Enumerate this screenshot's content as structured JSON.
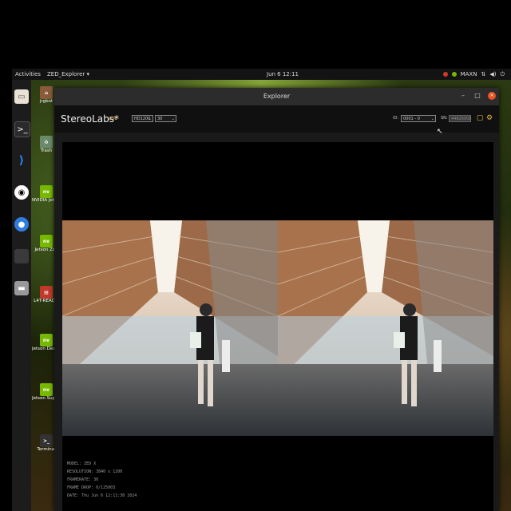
{
  "topbar": {
    "activities": "Activities",
    "app_menu": "ZED_Explorer ▾",
    "clock": "Jun 6 12:11",
    "power_mode": "MAXN",
    "tray_icons": [
      "nvidia-icon",
      "power-mode-icon",
      "network-icon",
      "volume-icon",
      "power-icon"
    ]
  },
  "dock": {
    "icons": [
      "files-icon",
      "terminal-icon",
      "vscode-icon",
      "obs-icon",
      "chromium-icon",
      "blank-app-icon",
      "disk-icon"
    ]
  },
  "desktop_icons": [
    {
      "label": "jrgbot",
      "icon": "home-folder-icon",
      "color": "#8a5a3a"
    },
    {
      "label": "Trash",
      "icon": "trash-icon",
      "color": "#6a8a6a"
    },
    {
      "label": "NVIDIA Jets Community F",
      "icon": "nvidia-icon",
      "color": "#76b900"
    },
    {
      "label": "Jetson Zoo",
      "icon": "nvidia-icon",
      "color": "#76b900"
    },
    {
      "label": "L4T-READM",
      "icon": "folder-icon",
      "color": "#c0392b"
    },
    {
      "label": "Jetson Developer Z",
      "icon": "nvidia-icon",
      "color": "#76b900"
    },
    {
      "label": "Jetson Supp Forums",
      "icon": "nvidia-icon",
      "color": "#76b900"
    },
    {
      "label": "Terminal",
      "icon": "terminal-icon",
      "color": "#333333"
    }
  ],
  "window": {
    "title": "Explorer",
    "buttons": {
      "minimize": "–",
      "maximize": "□",
      "close": "×"
    }
  },
  "toolbar": {
    "brand": "StereoLabs*",
    "live": "LIVE",
    "resolution_select": "HD1200",
    "fps_select": "30",
    "id_label": "ID:",
    "camera_select": "0001 - 0",
    "sn_label": "SN:",
    "serial_placeholder": "44826908"
  },
  "info": {
    "model": "MODEL: ZED X",
    "resolution": "RESOLUTION: 3840 x 1200",
    "framerate": "FRAMERATE: 30",
    "frame_drop": "FRAME DROP: 0/125003",
    "date": "DATE: Thu Jun 6 12:11:30 2024"
  },
  "colors": {
    "accent": "#e6b84c",
    "ubuntu_close": "#e95420",
    "nvidia_green": "#76b900"
  }
}
